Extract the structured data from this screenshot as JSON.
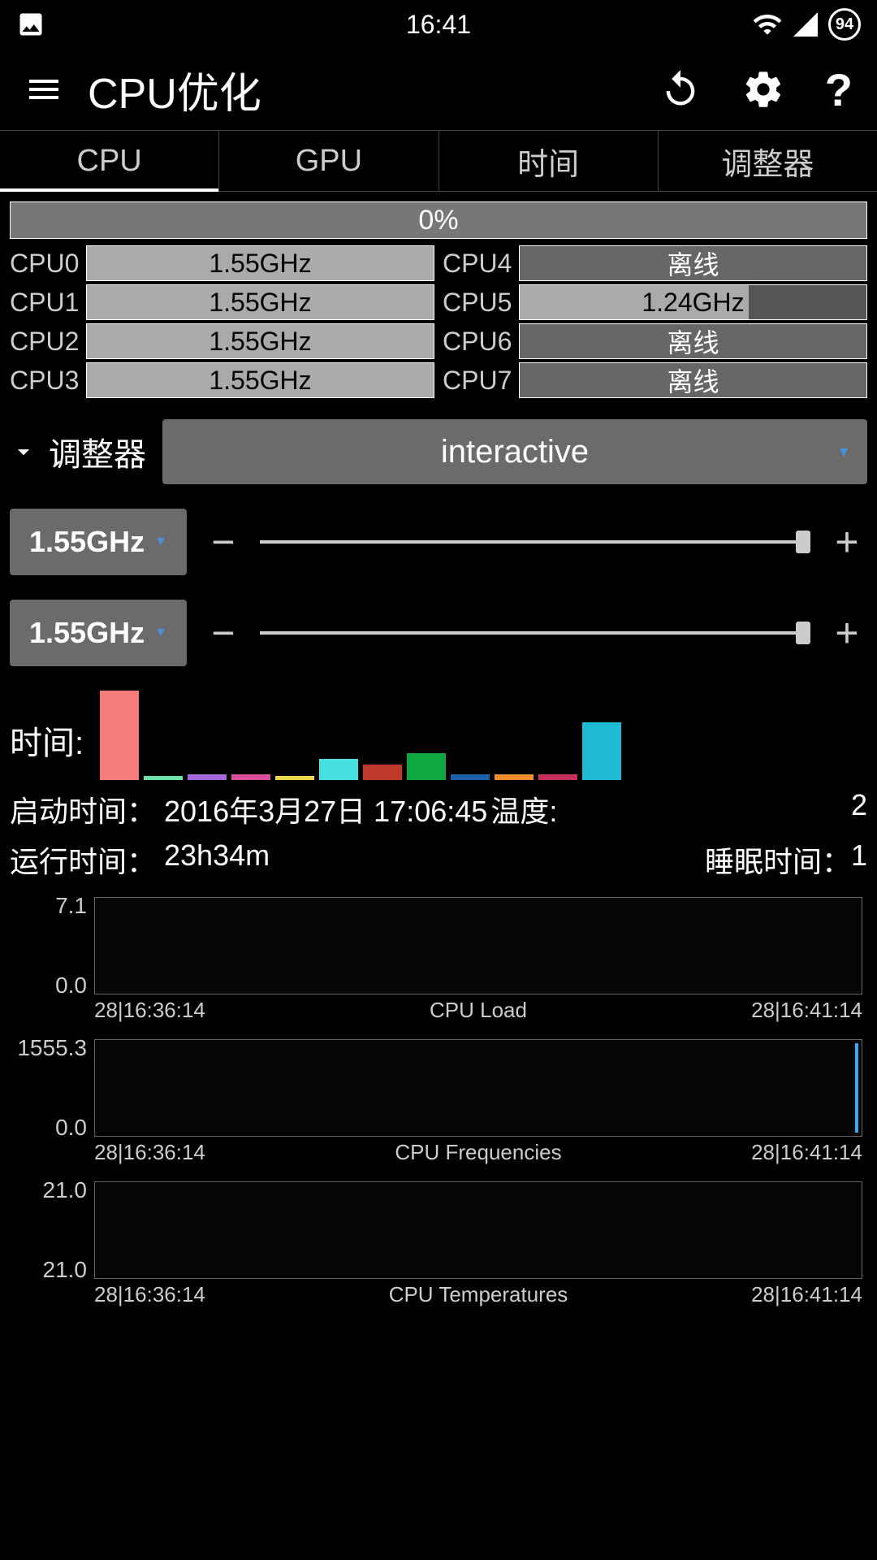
{
  "status_bar": {
    "time": "16:41",
    "battery": "94"
  },
  "header": {
    "title": "CPU优化"
  },
  "tabs": [
    "CPU",
    "GPU",
    "时间",
    "调整器"
  ],
  "usage_percent": "0%",
  "cores": [
    {
      "label": "CPU0",
      "value": "1.55GHz",
      "state": "full"
    },
    {
      "label": "CPU4",
      "value": "离线",
      "state": "offline"
    },
    {
      "label": "CPU1",
      "value": "1.55GHz",
      "state": "full"
    },
    {
      "label": "CPU5",
      "value": "1.24GHz",
      "state": "partial"
    },
    {
      "label": "CPU2",
      "value": "1.55GHz",
      "state": "full"
    },
    {
      "label": "CPU6",
      "value": "离线",
      "state": "offline"
    },
    {
      "label": "CPU3",
      "value": "1.55GHz",
      "state": "full"
    },
    {
      "label": "CPU7",
      "value": "离线",
      "state": "offline"
    }
  ],
  "governor": {
    "label": "调整器",
    "value": "interactive"
  },
  "freq_max": "1.55GHz",
  "freq_min": "1.55GHz",
  "time_label": "时间:",
  "chart_data": {
    "type": "bar",
    "title": "时间",
    "categories": [
      "b1",
      "b2",
      "b3",
      "b4",
      "b5",
      "b6",
      "b7",
      "b8",
      "b9",
      "b10",
      "b11",
      "b12"
    ],
    "values": [
      100,
      5,
      6,
      6,
      5,
      24,
      17,
      30,
      6,
      6,
      6,
      65
    ],
    "colors": [
      "#f47c7c",
      "#6de0a8",
      "#a566d9",
      "#d94f9c",
      "#e6d84a",
      "#49e0e0",
      "#c0392b",
      "#0fa83f",
      "#1c5faa",
      "#f08c2e",
      "#c9305c",
      "#1fbad6"
    ],
    "ylim": [
      0,
      100
    ]
  },
  "boot": {
    "label": "启动时间：",
    "value": "2016年3月27日 17:06:45",
    "temp_label": "温度:",
    "temp_value": "2"
  },
  "uptime": {
    "label": "运行时间：",
    "value": "23h34m",
    "sleep_label": "睡眠时间：",
    "sleep_value": "1"
  },
  "charts": [
    {
      "title": "CPU Load",
      "ytop": "7.1",
      "ybot": "0.0",
      "xleft": "28|16:36:14",
      "xright": "28|16:41:14",
      "spike": false
    },
    {
      "title": "CPU Frequencies",
      "ytop": "1555.3",
      "ybot": "0.0",
      "xleft": "28|16:36:14",
      "xright": "28|16:41:14",
      "spike": true
    },
    {
      "title": "CPU Temperatures",
      "ytop": "21.0",
      "ybot": "21.0",
      "xleft": "28|16:36:14",
      "xright": "28|16:41:14",
      "spike": false
    }
  ]
}
